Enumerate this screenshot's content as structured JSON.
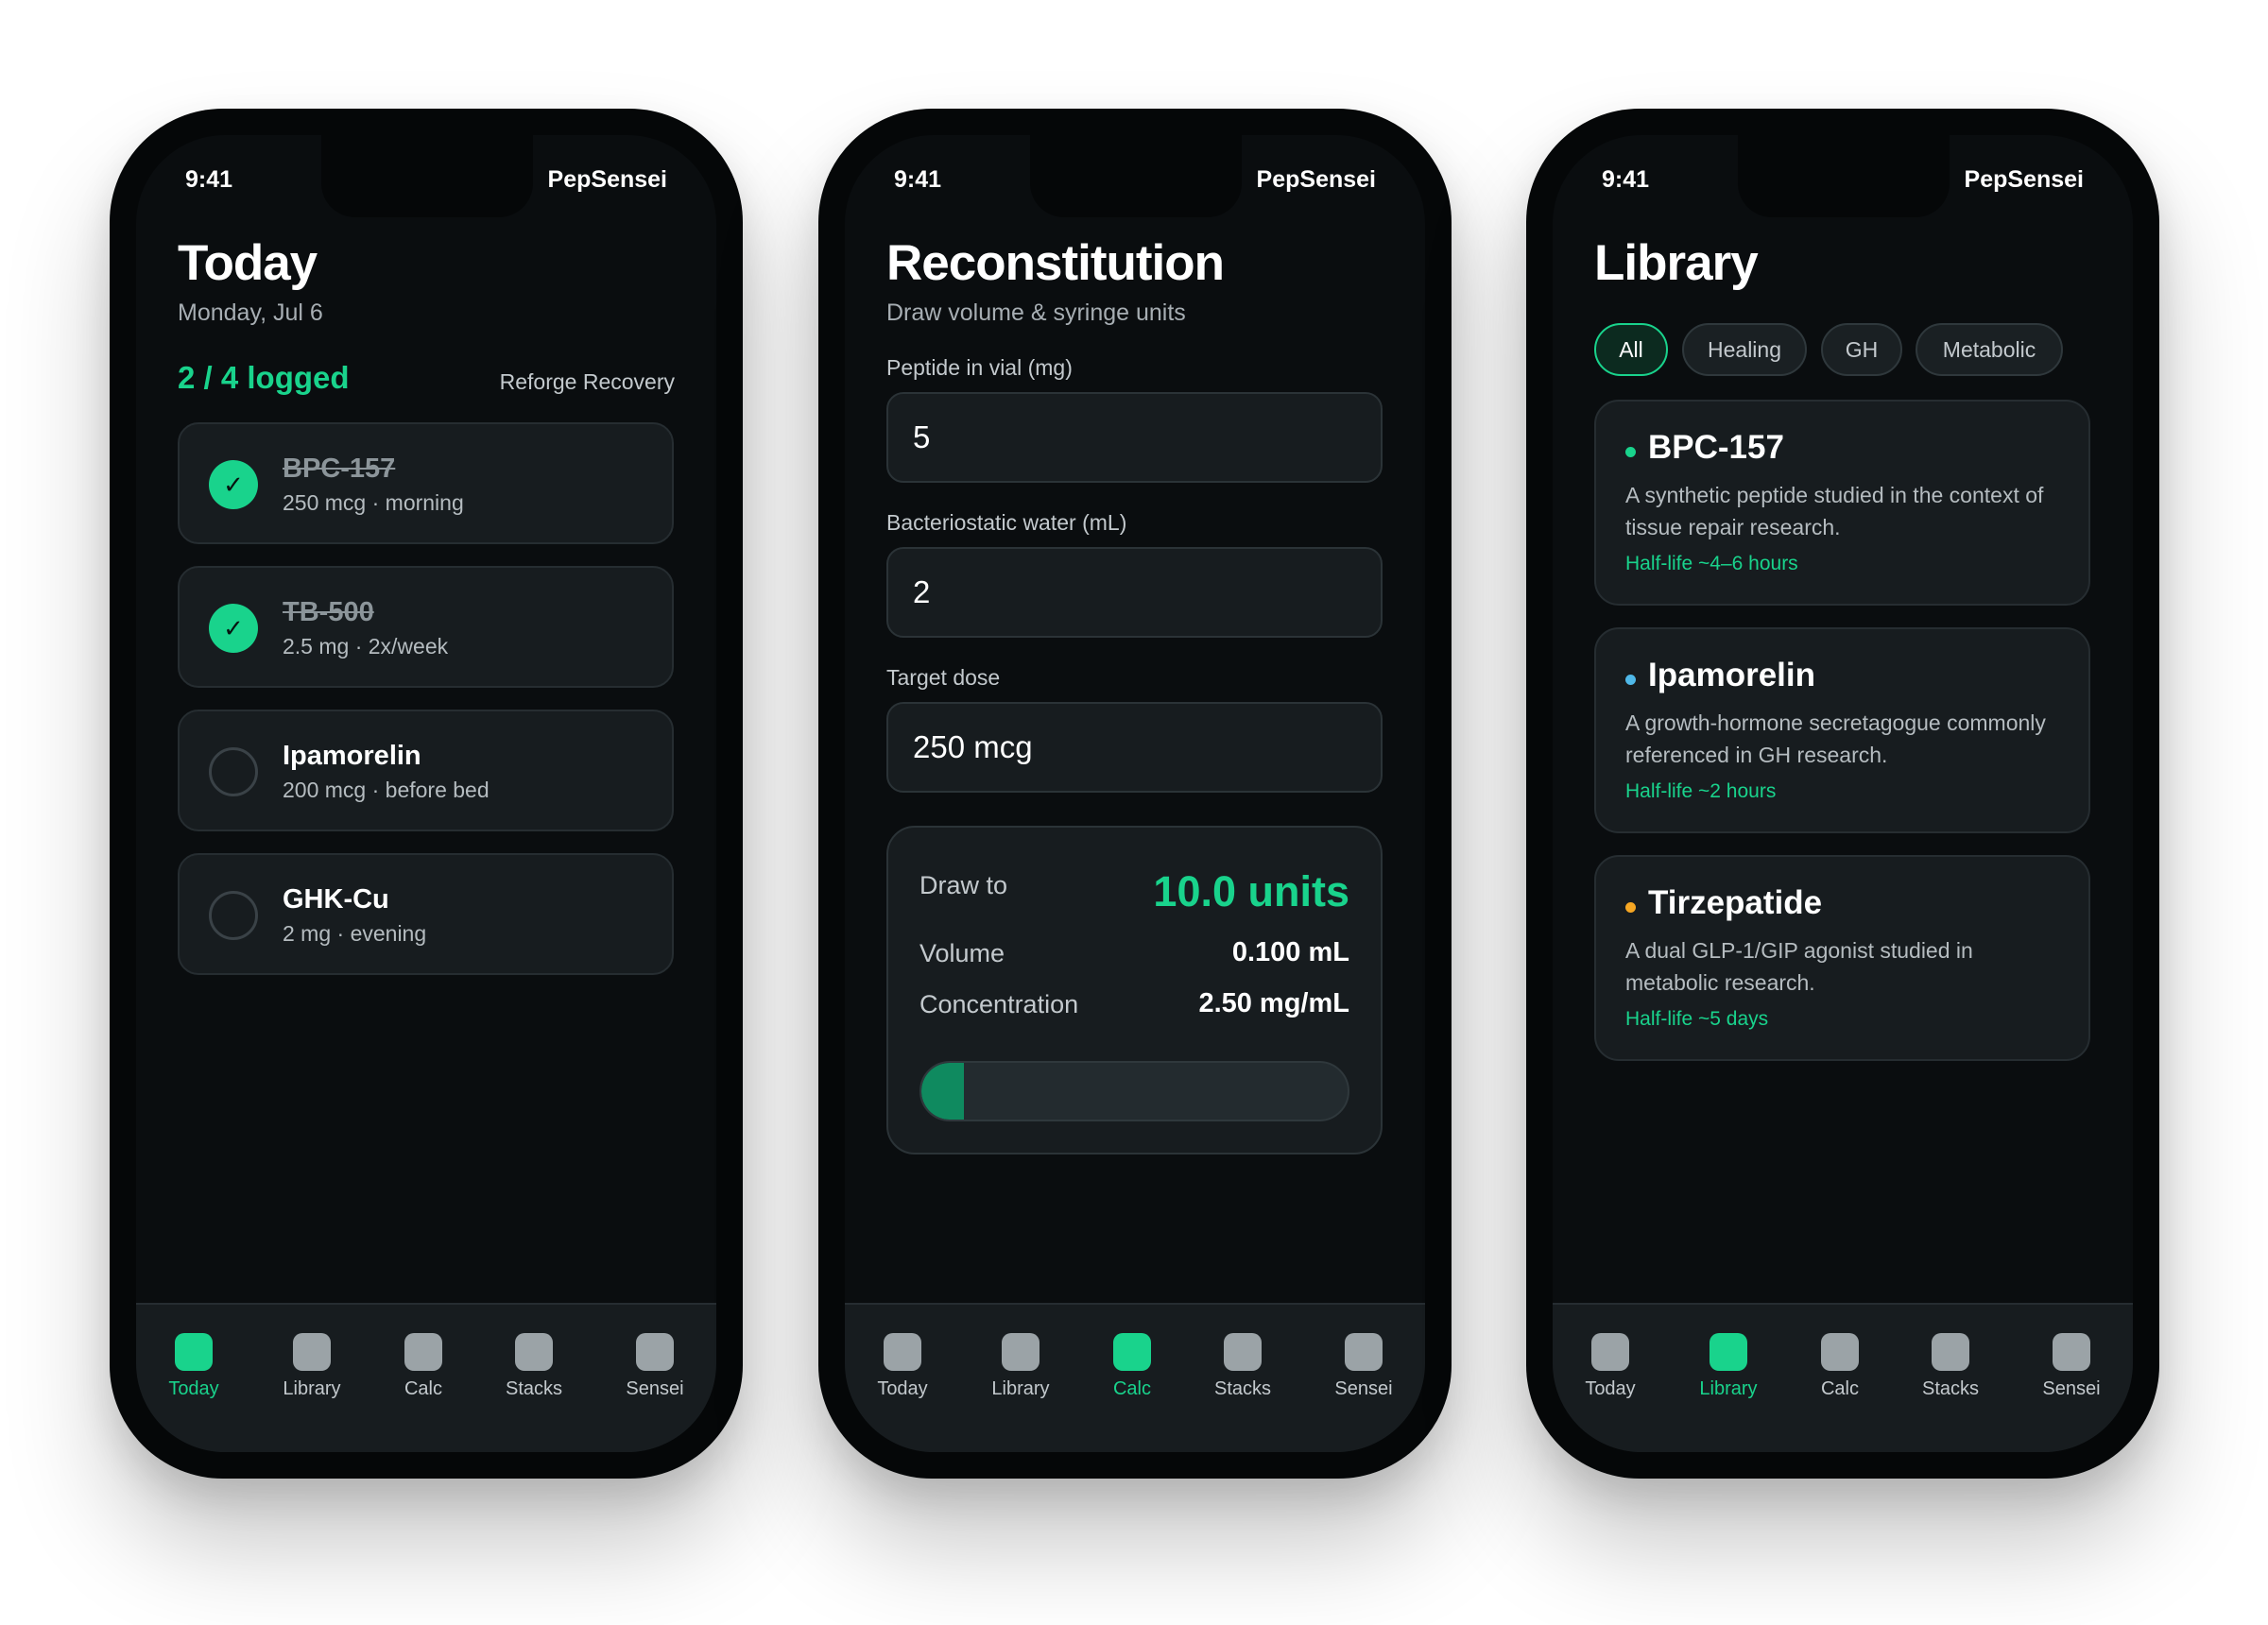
{
  "colors": {
    "accent": "#19d38c",
    "background": "#0a0d0f",
    "card": "#171c1f",
    "library_dots": [
      "#19d38c",
      "#4fb8e8",
      "#f5a623"
    ]
  },
  "status": {
    "time": "9:41",
    "app": "PepSensei"
  },
  "tabs": [
    "Today",
    "Library",
    "Calc",
    "Stacks",
    "Sensei"
  ],
  "today": {
    "title": "Today",
    "date": "Monday, Jul 6",
    "logged": "2 / 4 logged",
    "stack": "Reforge Recovery",
    "doses": [
      {
        "name": "BPC-157",
        "detail": "250 mcg · morning",
        "done": true,
        "icon": "check-icon"
      },
      {
        "name": "TB-500",
        "detail": "2.5 mg · 2x/week",
        "done": true,
        "icon": "check-icon"
      },
      {
        "name": "Ipamorelin",
        "detail": "200 mcg · before bed",
        "done": false
      },
      {
        "name": "GHK-Cu",
        "detail": "2 mg · evening",
        "done": false
      }
    ],
    "check_glyph": "✓"
  },
  "calc": {
    "title": "Reconstitution",
    "subtitle": "Draw volume & syringe units",
    "fields": [
      {
        "label": "Peptide in vial (mg)",
        "value": "5"
      },
      {
        "label": "Bacteriostatic water (mL)",
        "value": "2"
      },
      {
        "label": "Target dose",
        "value": "250 mcg"
      }
    ],
    "draw_label": "Draw to",
    "draw_value": "10.0 units",
    "volume_label": "Volume",
    "volume_value": "0.100 mL",
    "conc_label": "Concentration",
    "conc_value": "2.50 mg/mL",
    "syringe_fill_fraction": 0.1
  },
  "library": {
    "title": "Library",
    "filters": [
      {
        "label": "All",
        "active": true
      },
      {
        "label": "Healing",
        "active": false
      },
      {
        "label": "GH",
        "active": false
      },
      {
        "label": "Metabolic",
        "active": false
      }
    ],
    "peptides": [
      {
        "name": "BPC-157",
        "desc": "A synthetic peptide studied in the context of tissue repair research.",
        "half_life": "Half-life ~4–6 hours"
      },
      {
        "name": "Ipamorelin",
        "desc": "A growth-hormone secretagogue commonly referenced in GH research.",
        "half_life": "Half-life ~2 hours"
      },
      {
        "name": "Tirzepatide",
        "desc": "A dual GLP-1/GIP agonist studied in metabolic research.",
        "half_life": "Half-life ~5 days"
      }
    ]
  }
}
